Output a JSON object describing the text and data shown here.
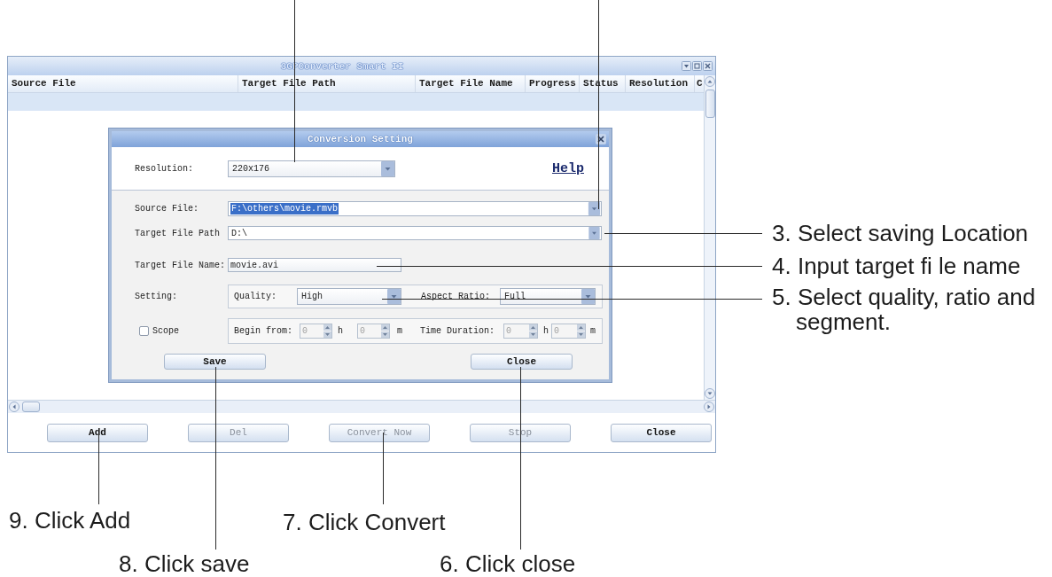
{
  "window": {
    "title": "3GPConverter Smart II"
  },
  "table": {
    "columns": [
      "Source File",
      "Target File Path",
      "Target File Name",
      "Progress",
      "Status",
      "Resolution",
      "C"
    ]
  },
  "dialog": {
    "title": "Conversion Setting",
    "resolution": {
      "label": "Resolution:",
      "value": "220x176"
    },
    "help_link": "Help",
    "source_file": {
      "label": "Source File:",
      "value": "F:\\others\\movie.rmvb",
      "highlighted": true
    },
    "target_file_path": {
      "label": "Target File Path",
      "value": "D:\\"
    },
    "target_file_name": {
      "label": "Target File Name:",
      "value": "movie.avi"
    },
    "setting": {
      "label": "Setting:",
      "quality": {
        "label": "Quality:",
        "value": "High"
      },
      "aspect_ratio": {
        "label": "Aspect Ratio:",
        "value": "Full"
      }
    },
    "scope": {
      "label": "Scope",
      "checked": false,
      "begin": {
        "label": "Begin from:",
        "fields": [
          {
            "value": "0",
            "unit": "h"
          },
          {
            "value": "0",
            "unit": "m"
          }
        ]
      },
      "duration": {
        "label": "Time Duration:",
        "fields": [
          {
            "value": "0",
            "unit": "h"
          },
          {
            "value": "0",
            "unit": "m"
          }
        ]
      }
    },
    "buttons": [
      "Save",
      "Close"
    ]
  },
  "toolbar": {
    "buttons": [
      {
        "label": "Add",
        "disabled": false
      },
      {
        "label": "Del",
        "disabled": true
      },
      {
        "label": "Convert Now",
        "disabled": true
      },
      {
        "label": "Stop",
        "disabled": true
      },
      {
        "label": "Close",
        "disabled": false
      }
    ]
  },
  "callouts": [
    {
      "text": "3. Select saving Location"
    },
    {
      "text": "4. Input target fi le name"
    },
    {
      "text": "5. Select quality, ratio and segment."
    },
    {
      "text": "9. Click Add"
    },
    {
      "text": "7. Click Convert"
    },
    {
      "text": "8. Click save"
    },
    {
      "text": "6. Click close"
    }
  ]
}
